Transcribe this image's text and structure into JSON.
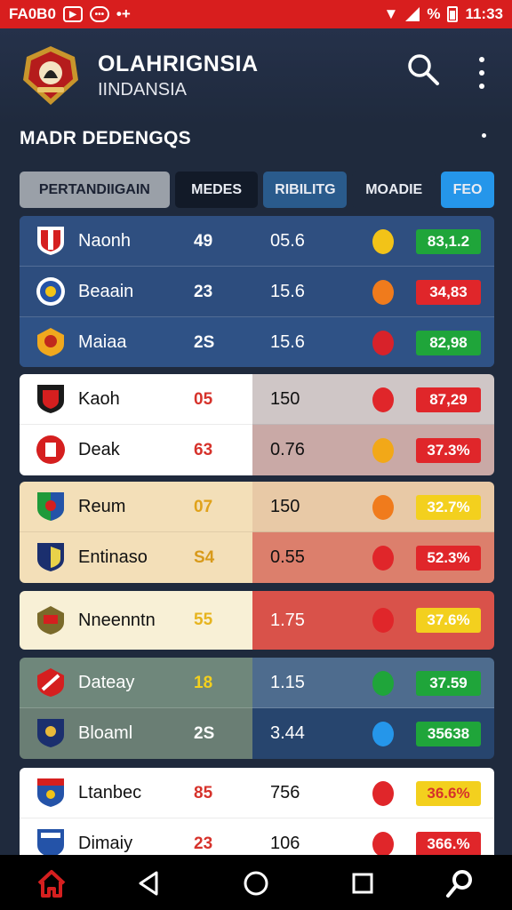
{
  "status_bar": {
    "left_text": "FA0B0",
    "time": "11:33",
    "percent": "%"
  },
  "header": {
    "app_title": "OLAHRIGNSIA",
    "app_subtitle": "IINDANSIA"
  },
  "section": {
    "title": "MADR DEDENGQS"
  },
  "tabs": [
    {
      "label": "PERTANDIIGAIN",
      "active": true
    },
    {
      "label": "MEDES"
    },
    {
      "label": "RIBILITG"
    },
    {
      "label": "MOADIE"
    },
    {
      "label": "FEO"
    }
  ],
  "rows": [
    {
      "team": "Naonh",
      "num": "49",
      "val": "05.6",
      "medal_color": "#f2c318",
      "pill": "83,1.2",
      "pill_color": "#1fa53a",
      "crest": "red"
    },
    {
      "team": "Beaain",
      "num": "23",
      "val": "15.6",
      "medal_color": "#f07b1c",
      "pill": "34,83",
      "pill_color": "#e0262a",
      "crest": "blue"
    },
    {
      "team": "Maiaa",
      "num": "2S",
      "val": "15.6",
      "medal_color": "#d8222a",
      "pill": "82,98",
      "pill_color": "#1fa53a",
      "crest": "gold"
    },
    {
      "team": "Kaoh",
      "num": "05",
      "val": "150",
      "medal_color": "#e0262a",
      "pill": "87,29",
      "pill_color": "#e0262a",
      "crest": "black"
    },
    {
      "team": "Deak",
      "num": "63",
      "val": "0.76",
      "medal_color": "#f2a818",
      "pill": "37.3%",
      "pill_color": "#e0262a",
      "crest": "redround"
    },
    {
      "team": "Reum",
      "num": "07",
      "val": "150",
      "medal_color": "#f07b1c",
      "pill": "32.7%",
      "pill_color": "#f3d01e",
      "crest": "bluered"
    },
    {
      "team": "Entinaso",
      "num": "S4",
      "val": "0.55",
      "medal_color": "#e0262a",
      "pill": "52.3%",
      "pill_color": "#e0262a",
      "crest": "navy"
    },
    {
      "team": "Nneenntn",
      "num": "55",
      "val": "1.75",
      "medal_color": "#e0262a",
      "pill": "37.6%",
      "pill_color": "#f3d01e",
      "crest": "olive"
    },
    {
      "team": "Dateay",
      "num": "18",
      "val": "1.15",
      "medal_color": "#1fa53a",
      "pill": "37.59",
      "pill_color": "#1fa53a",
      "crest": "redwhite"
    },
    {
      "team": "Bloaml",
      "num": "2S",
      "val": "3.44",
      "medal_color": "#2596ea",
      "pill": "35638",
      "pill_color": "#1fa53a",
      "crest": "navygold"
    },
    {
      "team": "Ltanbec",
      "num": "85",
      "val": "756",
      "medal_color": "#e0262a",
      "pill": "36.6%",
      "pill_color": "#f3d01e",
      "crest": "blueflag"
    },
    {
      "team": "Dimaiy",
      "num": "23",
      "val": "106",
      "medal_color": "#e0262a",
      "pill": "366.%",
      "pill_color": "#e0262a",
      "crest": "bluewhite"
    }
  ],
  "navbar": {
    "items": [
      "home-icon",
      "back-icon",
      "home-circle-icon",
      "recents-icon",
      "search-icon"
    ]
  }
}
